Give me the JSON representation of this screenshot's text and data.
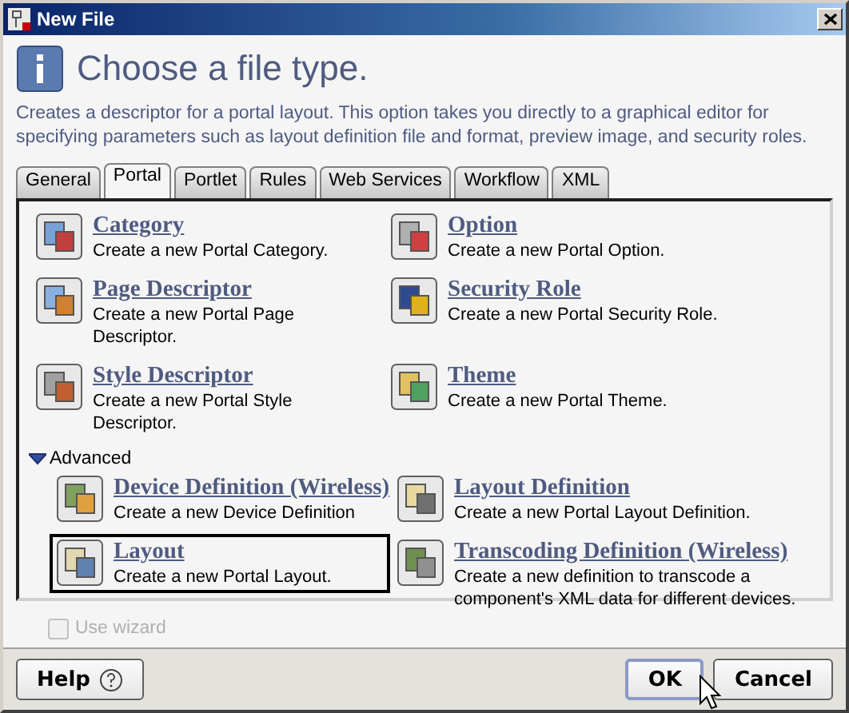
{
  "window": {
    "title": "New File"
  },
  "header": {
    "title": "Choose a file type.",
    "description": "Creates a descriptor for a portal layout. This option takes you directly to a graphical editor for specifying parameters such as layout definition file and format, preview image, and security roles."
  },
  "tabs": [
    {
      "label": "General",
      "selected": false
    },
    {
      "label": "Portal",
      "selected": true
    },
    {
      "label": "Portlet",
      "selected": false
    },
    {
      "label": "Rules",
      "selected": false
    },
    {
      "label": "Web Services",
      "selected": false
    },
    {
      "label": "Workflow",
      "selected": false
    },
    {
      "label": "XML",
      "selected": false
    }
  ],
  "items": [
    {
      "title": "Category",
      "description": "Create a new Portal Category.",
      "selected": false
    },
    {
      "title": "Option",
      "description": "Create a new Portal Option.",
      "selected": false
    },
    {
      "title": "Page Descriptor",
      "description": "Create a new Portal Page Descriptor.",
      "selected": false
    },
    {
      "title": "Security Role",
      "description": "Create a new Portal Security Role.",
      "selected": false
    },
    {
      "title": "Style Descriptor",
      "description": "Create a new Portal Style Descriptor.",
      "selected": false
    },
    {
      "title": "Theme",
      "description": "Create a new Portal Theme.",
      "selected": false
    }
  ],
  "advanced": {
    "label": "Advanced",
    "expanded": true,
    "items": [
      {
        "title": "Device Definition (Wireless)",
        "description": "Create a new Device Definition",
        "selected": false
      },
      {
        "title": "Layout Definition",
        "description": "Create a new Portal Layout Definition.",
        "selected": false
      },
      {
        "title": "Layout",
        "description": "Create a new Portal Layout.",
        "selected": true
      },
      {
        "title": "Transcoding Definition (Wireless)",
        "description": "Create a new definition to transcode a component's XML data for different devices.",
        "selected": false
      }
    ]
  },
  "use_wizard": {
    "label": "Use wizard",
    "checked": false,
    "disabled": true
  },
  "buttons": [
    {
      "label": "Help",
      "kind": "help"
    },
    {
      "label": "OK",
      "kind": "default"
    },
    {
      "label": "Cancel",
      "kind": "normal"
    }
  ]
}
